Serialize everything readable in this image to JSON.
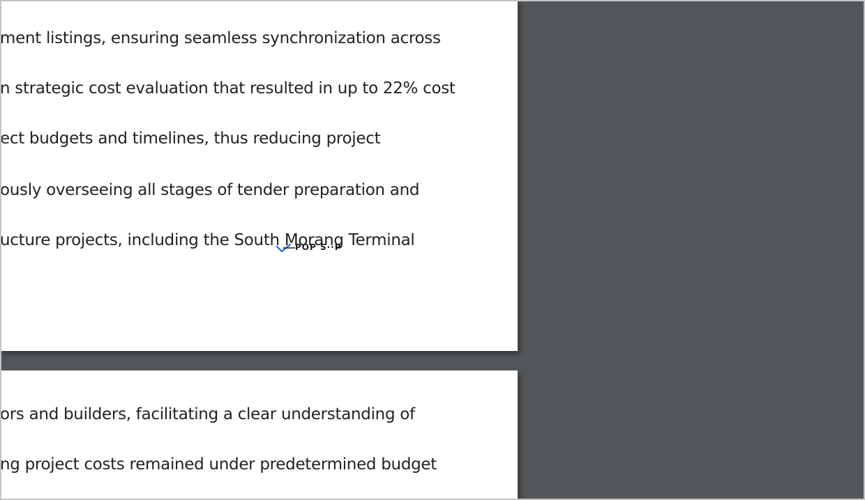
{
  "colors": {
    "background": "#54575a",
    "page": "#ffffff",
    "text": "#222222",
    "checkmark": "#1f6fd6"
  },
  "pages": [
    {
      "lines": [
        "ment listings, ensuring seamless synchronization across",
        "n strategic cost evaluation that resulted in up to 22% cost",
        "ect budgets and timelines, thus reducing project",
        "ously overseeing all stages of tender preparation and",
        "ucture projects, including the South Morang Terminal"
      ]
    },
    {
      "lines": [
        "ors and builders, facilitating a clear understanding of",
        "ng project costs remained under predetermined budget"
      ]
    }
  ],
  "spell_widget": {
    "icon": "checkmark-icon",
    "text": "POP S··P"
  }
}
